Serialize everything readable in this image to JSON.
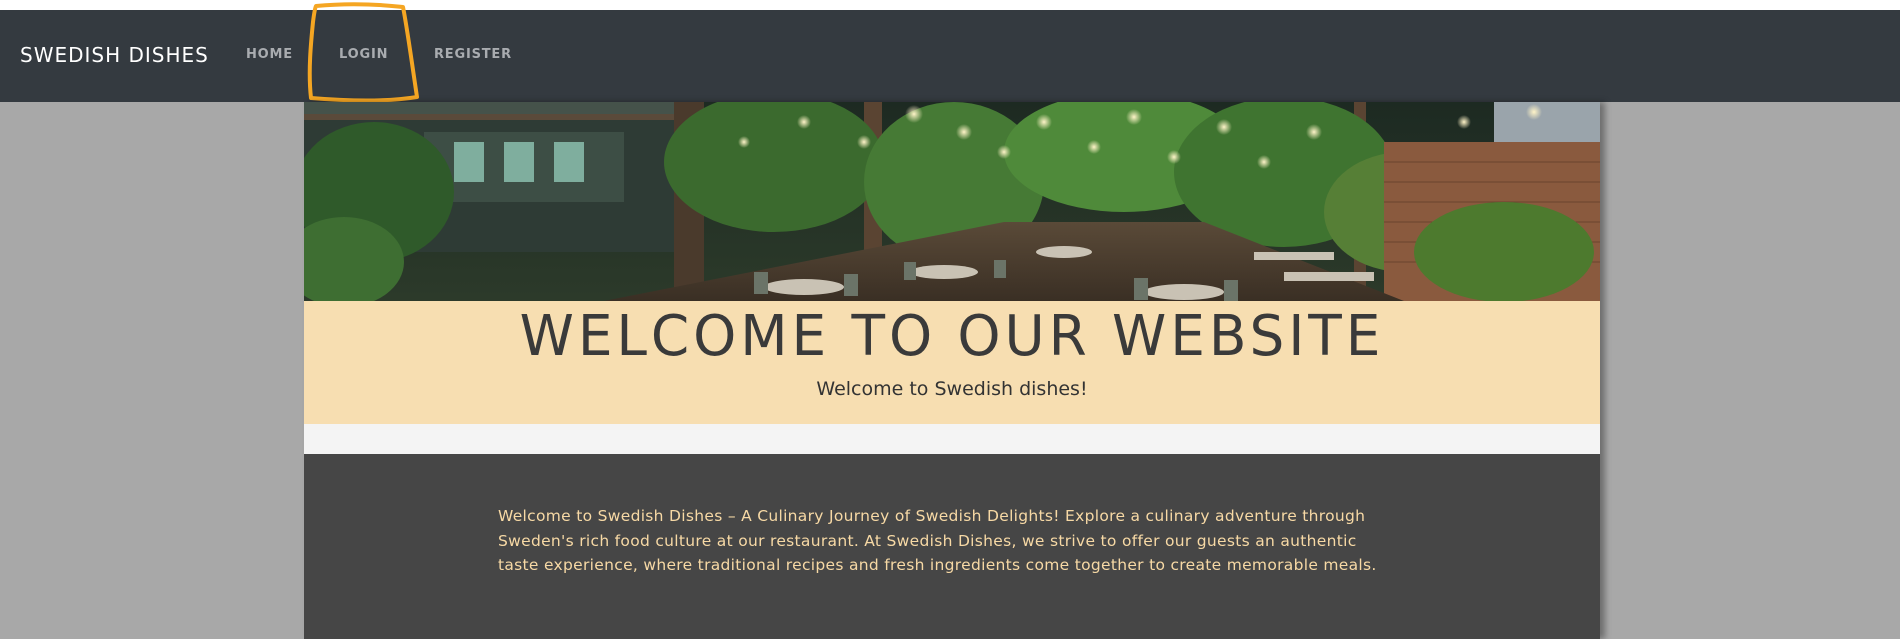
{
  "navbar": {
    "brand": "SWEDISH DISHES",
    "links": [
      {
        "label": "HOME"
      },
      {
        "label": "LOGIN"
      },
      {
        "label": "REGISTER"
      }
    ],
    "highlight_color": "#f5a623"
  },
  "hero": {
    "image_description": "restaurant-garden-photo"
  },
  "banner": {
    "title": "WELCOME TO OUR WEBSITE",
    "subtitle": "Welcome to Swedish dishes!"
  },
  "content": {
    "intro": "Welcome to Swedish Dishes – A Culinary Journey of Swedish Delights! Explore a culinary adventure through Sweden's rich food culture at our restaurant. At Swedish Dishes, we strive to offer our guests an authentic taste experience, where traditional recipes and fresh ingredients come together to create memorable meals."
  },
  "colors": {
    "navbar": "#343a40",
    "banner": "#f7deb1",
    "content_bg": "#464646",
    "content_text": "#f7d9a5",
    "page_bg": "#a8a8a8"
  }
}
